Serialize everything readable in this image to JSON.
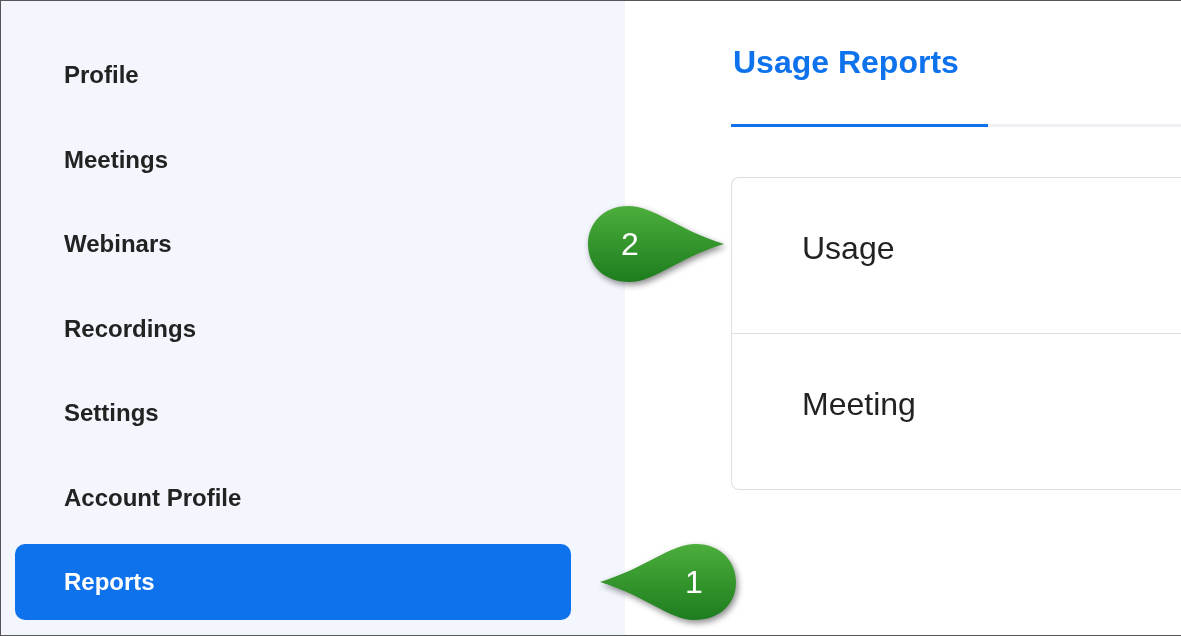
{
  "sidebar": {
    "items": [
      {
        "label": "Profile",
        "selected": false
      },
      {
        "label": "Meetings",
        "selected": false
      },
      {
        "label": "Webinars",
        "selected": false
      },
      {
        "label": "Recordings",
        "selected": false
      },
      {
        "label": "Settings",
        "selected": false
      },
      {
        "label": "Account Profile",
        "selected": false
      },
      {
        "label": "Reports",
        "selected": true
      }
    ]
  },
  "tab": {
    "label": "Usage Reports",
    "selected": true
  },
  "report_list": {
    "items": [
      "Usage",
      "Meeting"
    ]
  },
  "callouts": [
    {
      "label": "2",
      "kind": "right"
    },
    {
      "label": "1",
      "kind": "left"
    }
  ]
}
